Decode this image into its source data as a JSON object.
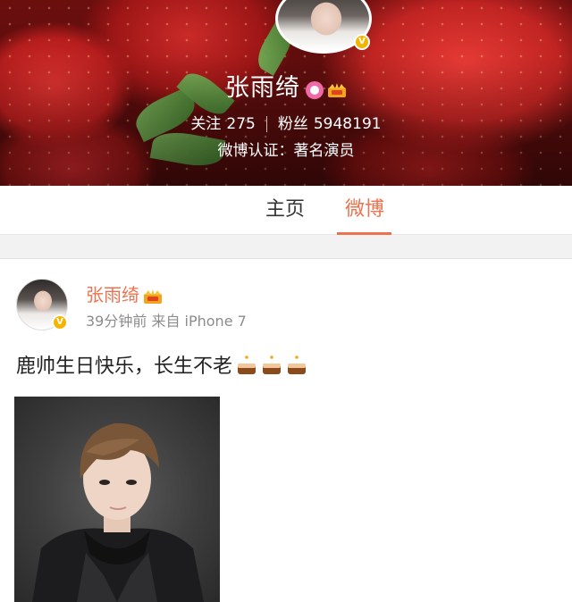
{
  "profile": {
    "name": "张雨绮",
    "following_label": "关注",
    "following_count": "275",
    "followers_label": "粉丝",
    "followers_count": "5948191",
    "verification": "微博认证：著名演员"
  },
  "tabs": [
    {
      "label": "主页",
      "active": false
    },
    {
      "label": "微博",
      "active": true
    }
  ],
  "post": {
    "author": "张雨绮",
    "meta": "39分钟前  来自 iPhone 7",
    "text": "鹿帅生日快乐，长生不老"
  },
  "icons": {
    "verified": "verified-v-badge",
    "member": "pink-member-icon",
    "crown": "crown-icon",
    "cake": "birthday-cake-emoji"
  },
  "colors": {
    "accent": "#eb7350",
    "verified": "#f5b400",
    "divider": "#f2f2f2"
  }
}
